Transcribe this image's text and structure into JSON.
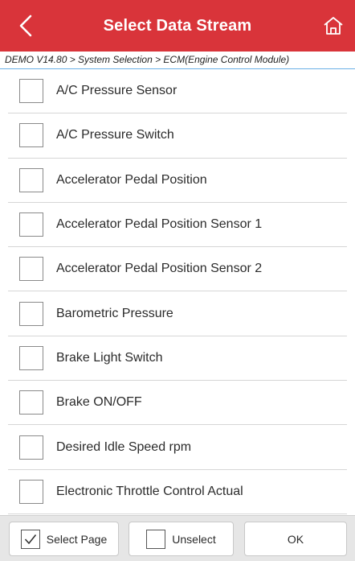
{
  "header": {
    "title": "Select Data Stream",
    "back_icon": "chevron-left-icon",
    "home_icon": "home-icon",
    "bg_color": "#d9343a"
  },
  "breadcrumb": "DEMO V14.80 > System Selection > ECM(Engine Control Module)",
  "items": [
    {
      "label": "A/C Pressure Sensor",
      "checked": false
    },
    {
      "label": "A/C Pressure Switch",
      "checked": false
    },
    {
      "label": "Accelerator Pedal Position",
      "checked": false
    },
    {
      "label": "Accelerator Pedal Position Sensor 1",
      "checked": false
    },
    {
      "label": "Accelerator Pedal Position Sensor 2",
      "checked": false
    },
    {
      "label": "Barometric Pressure",
      "checked": false
    },
    {
      "label": "Brake Light Switch",
      "checked": false
    },
    {
      "label": "Brake ON/OFF",
      "checked": false
    },
    {
      "label": "Desired Idle Speed rpm",
      "checked": false
    },
    {
      "label": "Electronic Throttle Control Actual",
      "checked": false
    }
  ],
  "footer": {
    "select_page_label": "Select Page",
    "select_page_checked": true,
    "unselect_label": "Unselect",
    "unselect_checked": false,
    "ok_label": "OK"
  }
}
